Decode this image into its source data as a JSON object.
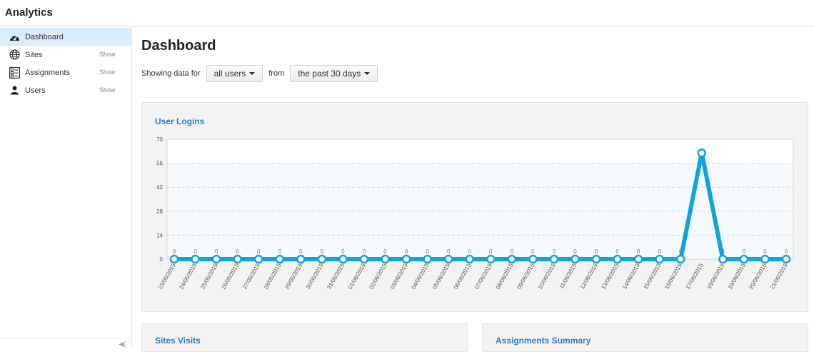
{
  "app": {
    "title": "Analytics"
  },
  "sidebar": {
    "items": [
      {
        "label": "Dashboard",
        "icon": "dashboard-icon",
        "show": "",
        "active": true
      },
      {
        "label": "Sites",
        "icon": "globe-icon",
        "show": "Show",
        "active": false
      },
      {
        "label": "Assignments",
        "icon": "assignments-icon",
        "show": "Show",
        "active": false
      },
      {
        "label": "Users",
        "icon": "user-icon",
        "show": "Show",
        "active": false
      }
    ]
  },
  "main": {
    "title": "Dashboard",
    "filters": {
      "prefix": "Showing data for",
      "users_value": "all users",
      "connector": "from",
      "period_value": "the past 30 days"
    },
    "panels": {
      "user_logins": "User Logins",
      "sites_visits": "Sites Visits",
      "assignments_summary": "Assignments Summary"
    }
  },
  "colors": {
    "accent": "#0ea5d8",
    "title_blue": "#2f7cb8",
    "active_bg": "#d9ecfa"
  },
  "chart_data": {
    "type": "line",
    "title": "User Logins",
    "categories": [
      "23/05/2015",
      "24/05/2015",
      "25/05/2015",
      "26/05/2015",
      "27/05/2015",
      "28/05/2015",
      "29/05/2015",
      "30/05/2015",
      "31/05/2015",
      "01/06/2015",
      "02/06/2015",
      "03/06/2015",
      "04/06/2015",
      "05/06/2015",
      "06/06/2015",
      "07/06/2015",
      "08/06/2015",
      "09/06/2015",
      "10/06/2015",
      "11/06/2015",
      "12/06/2015",
      "13/06/2015",
      "14/06/2015",
      "15/06/2015",
      "16/06/2015",
      "17/06/2015",
      "18/06/2015",
      "19/06/2015",
      "20/06/2015",
      "21/06/2015"
    ],
    "values": [
      0,
      0,
      0,
      0,
      0,
      0,
      0,
      0,
      0,
      0,
      0,
      0,
      0,
      0,
      0,
      0,
      0,
      0,
      0,
      0,
      0,
      0,
      0,
      0,
      0,
      62,
      0,
      0,
      0,
      0
    ],
    "data_labels": [
      "0",
      "0",
      "0",
      "0",
      "0",
      "0",
      "0",
      "0",
      "0",
      "0",
      "0",
      "0",
      "0",
      "0",
      "0",
      "0",
      "0",
      "0",
      "0",
      "0",
      "0",
      "0",
      "0",
      "0",
      "0",
      "",
      "0",
      "0",
      "0",
      "0"
    ],
    "yticks": [
      0,
      14,
      28,
      42,
      56,
      70
    ],
    "ylim": [
      0,
      70
    ],
    "grid": true
  }
}
